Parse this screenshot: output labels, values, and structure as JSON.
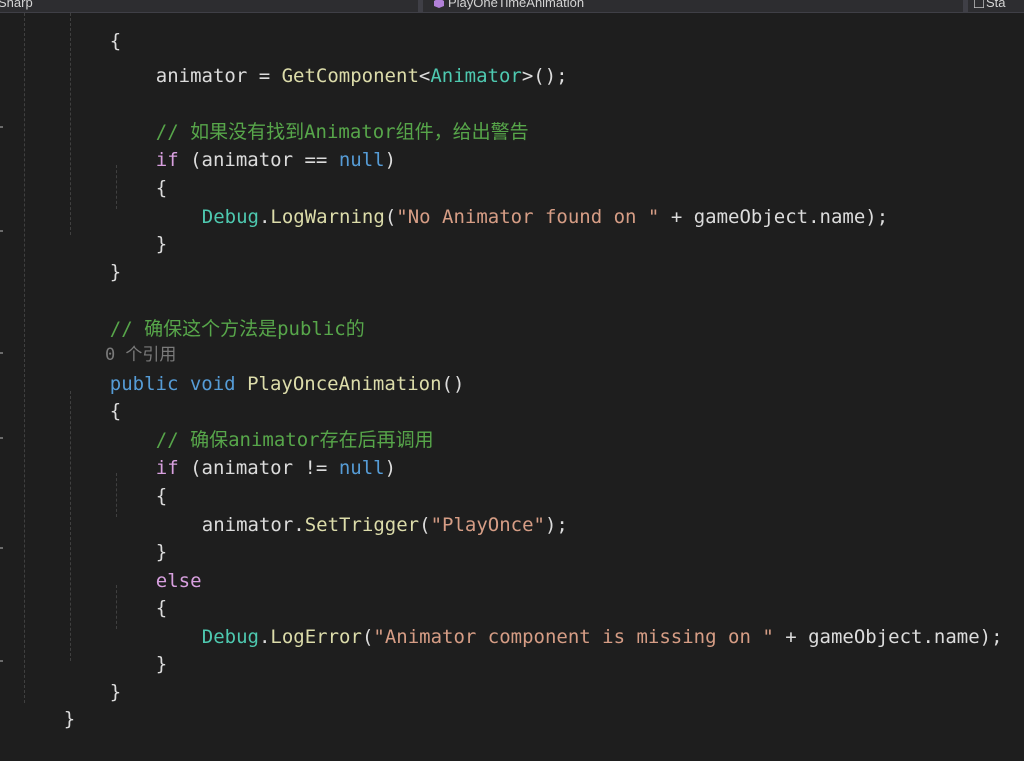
{
  "nav": {
    "project_segment": "Sharp",
    "member_segment": "PlayOneTimeAnimation",
    "scope_segment": "Sta"
  },
  "code": {
    "l01_brace": "{",
    "l02_var": "animator",
    "l02_eq": " = ",
    "l02_method": "GetComponent",
    "l02_lt": "<",
    "l02_type": "Animator",
    "l02_tail": ">();",
    "l04_comment": "// 如果没有找到Animator组件，给出警告",
    "l05_if": "if",
    "l05_cond": " (animator == ",
    "l05_null": "null",
    "l05_close": ")",
    "l06_brace": "{",
    "l07_type": "Debug",
    "l07_dot": ".",
    "l07_method": "LogWarning",
    "l07_open": "(",
    "l07_str": "\"No Animator found on \"",
    "l07_tail": " + gameObject.name);",
    "l08_brace": "}",
    "l09_brace": "}",
    "l11_comment": "// 确保这个方法是public的",
    "l12_lens": "0 个引用",
    "l13_public": "public",
    "l13_void": "void",
    "l13_method": "PlayOnceAnimation",
    "l13_tail": "()",
    "l14_brace": "{",
    "l15_comment": "// 确保animator存在后再调用",
    "l16_if": "if",
    "l16_cond": " (animator != ",
    "l16_null": "null",
    "l16_close": ")",
    "l17_brace": "{",
    "l18_obj": "animator.",
    "l18_method": "SetTrigger",
    "l18_open": "(",
    "l18_str": "\"PlayOnce\"",
    "l18_tail": ");",
    "l19_brace": "}",
    "l20_else": "else",
    "l21_brace": "{",
    "l22_type": "Debug",
    "l22_dot": ".",
    "l22_method": "LogError",
    "l22_open": "(",
    "l22_str": "\"Animator component is missing on \"",
    "l22_tail": " + gameObject.name);",
    "l23_brace": "}",
    "l24_brace": "}",
    "l25_brace": "}"
  },
  "colors": {
    "background": "#1e1e1e",
    "comment": "#57a64a",
    "keyword": "#569cd6",
    "control_keyword": "#d8a0df",
    "type": "#4ec9b0",
    "method": "#dcdcaa",
    "string": "#d69d85",
    "text": "#dcdcdc"
  }
}
